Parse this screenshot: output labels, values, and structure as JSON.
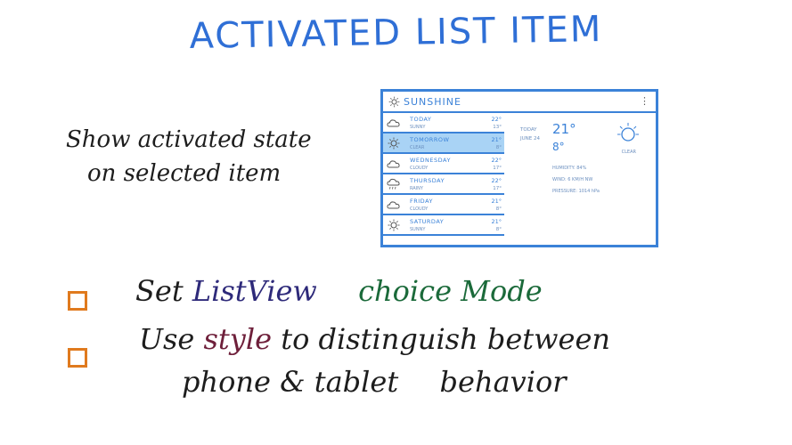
{
  "title": "ACTIVATED LIST ITEM",
  "side_note": {
    "line1": "Show activated state",
    "line2": "on selected item"
  },
  "app": {
    "name": "SUNSHINE",
    "menu_icon": "⋮",
    "list": [
      {
        "day": "TODAY",
        "desc": "SUNNY",
        "hi": "22°",
        "lo": "13°",
        "icon": "cloud-icon",
        "active": false
      },
      {
        "day": "TOMORROW",
        "desc": "CLEAR",
        "hi": "21°",
        "lo": "8°",
        "icon": "sun-icon",
        "active": true
      },
      {
        "day": "WEDNESDAY",
        "desc": "CLOUDY",
        "hi": "22°",
        "lo": "17°",
        "icon": "cloud-icon",
        "active": false
      },
      {
        "day": "THURSDAY",
        "desc": "RAINY",
        "hi": "22°",
        "lo": "17°",
        "icon": "rain-icon",
        "active": false
      },
      {
        "day": "FRIDAY",
        "desc": "CLOUDY",
        "hi": "21°",
        "lo": "8°",
        "icon": "cloud-icon",
        "active": false
      },
      {
        "day": "SATURDAY",
        "desc": "SUNNY",
        "hi": "21°",
        "lo": "8°",
        "icon": "sun-icon",
        "active": false
      }
    ],
    "detail": {
      "day_line1": "TODAY",
      "day_line2": "JUNE 24",
      "hi": "21°",
      "lo": "8°",
      "condition": "CLEAR",
      "humidity": "HUMIDITY: 84%",
      "wind": "WIND: 6 KM/H NW",
      "pressure": "PRESSURE: 1014 hPa"
    }
  },
  "tasks": {
    "t1": {
      "a": "Set",
      "b": "ListView",
      "c": "choice Mode"
    },
    "t2": {
      "a": "Use",
      "b": "style",
      "c": "to distinguish between",
      "d": "phone & tablet",
      "e": "behavior"
    }
  },
  "colors": {
    "accent": "#3b82d8",
    "checkbox": "#e07a1e",
    "active_row": "#a9d3f5"
  }
}
